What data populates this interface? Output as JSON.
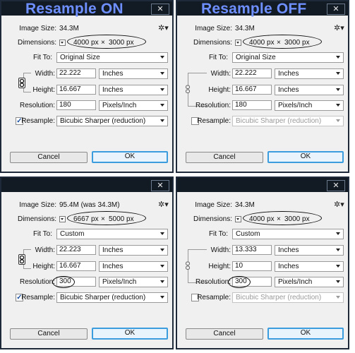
{
  "panels": [
    {
      "title": "Resample ON",
      "image_size_label": "Image Size:",
      "image_size_value": "34.3M",
      "dimensions_label": "Dimensions:",
      "dim_w": "4000 px",
      "dim_x": "×",
      "dim_h": "3000 px",
      "fit_label": "Fit To:",
      "fit_value": "Original Size",
      "width_label": "Width:",
      "width_value": "22.222",
      "width_unit": "Inches",
      "height_label": "Height:",
      "height_value": "16.667",
      "height_unit": "Inches",
      "res_label": "Resolution:",
      "res_value": "180",
      "res_unit": "Pixels/Inch",
      "resample_label": "Resample:",
      "resample_checked": true,
      "resample_method": "Bicubic Sharper (reduction)",
      "resample_disabled": false,
      "constrain_linked": true,
      "res_circled": false,
      "cancel_label": "Cancel",
      "ok_label": "OK"
    },
    {
      "title": "Resample OFF",
      "image_size_label": "Image Size:",
      "image_size_value": "34.3M",
      "dimensions_label": "Dimensions:",
      "dim_w": "4000 px",
      "dim_x": "×",
      "dim_h": "3000 px",
      "fit_label": "Fit To:",
      "fit_value": "Original Size",
      "width_label": "Width:",
      "width_value": "22.222",
      "width_unit": "Inches",
      "height_label": "Height:",
      "height_value": "16.667",
      "height_unit": "Inches",
      "res_label": "Resolution:",
      "res_value": "180",
      "res_unit": "Pixels/Inch",
      "resample_label": "Resample:",
      "resample_checked": false,
      "resample_method": "Bicubic Sharper (reduction)",
      "resample_disabled": true,
      "constrain_linked": false,
      "res_circled": false,
      "cancel_label": "Cancel",
      "ok_label": "OK"
    },
    {
      "title": "",
      "image_size_label": "Image Size:",
      "image_size_value": "95.4M (was 34.3M)",
      "dimensions_label": "Dimensions:",
      "dim_w": "6667 px",
      "dim_x": "×",
      "dim_h": "5000 px",
      "fit_label": "Fit To:",
      "fit_value": "Custom",
      "width_label": "Width:",
      "width_value": "22.223",
      "width_unit": "Inches",
      "height_label": "Height:",
      "height_value": "16.667",
      "height_unit": "Inches",
      "res_label": "Resolution:",
      "res_value": "300",
      "res_unit": "Pixels/Inch",
      "resample_label": "Resample:",
      "resample_checked": true,
      "resample_method": "Bicubic Sharper (reduction)",
      "resample_disabled": false,
      "constrain_linked": true,
      "res_circled": true,
      "cancel_label": "Cancel",
      "ok_label": "OK"
    },
    {
      "title": "",
      "image_size_label": "Image Size:",
      "image_size_value": "34.3M",
      "dimensions_label": "Dimensions:",
      "dim_w": "4000 px",
      "dim_x": "×",
      "dim_h": "3000 px",
      "fit_label": "Fit To:",
      "fit_value": "Custom",
      "width_label": "Width:",
      "width_value": "13.333",
      "width_unit": "Inches",
      "height_label": "Height:",
      "height_value": "10",
      "height_unit": "Inches",
      "res_label": "Resolution:",
      "res_value": "300",
      "res_unit": "Pixels/Inch",
      "resample_label": "Resample:",
      "resample_checked": false,
      "resample_method": "Bicubic Sharper (reduction)",
      "resample_disabled": true,
      "constrain_linked": false,
      "res_circled": true,
      "cancel_label": "Cancel",
      "ok_label": "OK"
    }
  ],
  "icons": {
    "close": "close-icon",
    "gear": "gear-icon",
    "chain": "chain-link-icon",
    "dropdown": "chevron-down-icon"
  },
  "colors": {
    "title_text": "#6e8fff",
    "titlebar": "#121a24",
    "dialog_bg": "#f0f0f0",
    "ok_border": "#3b9ddd"
  }
}
